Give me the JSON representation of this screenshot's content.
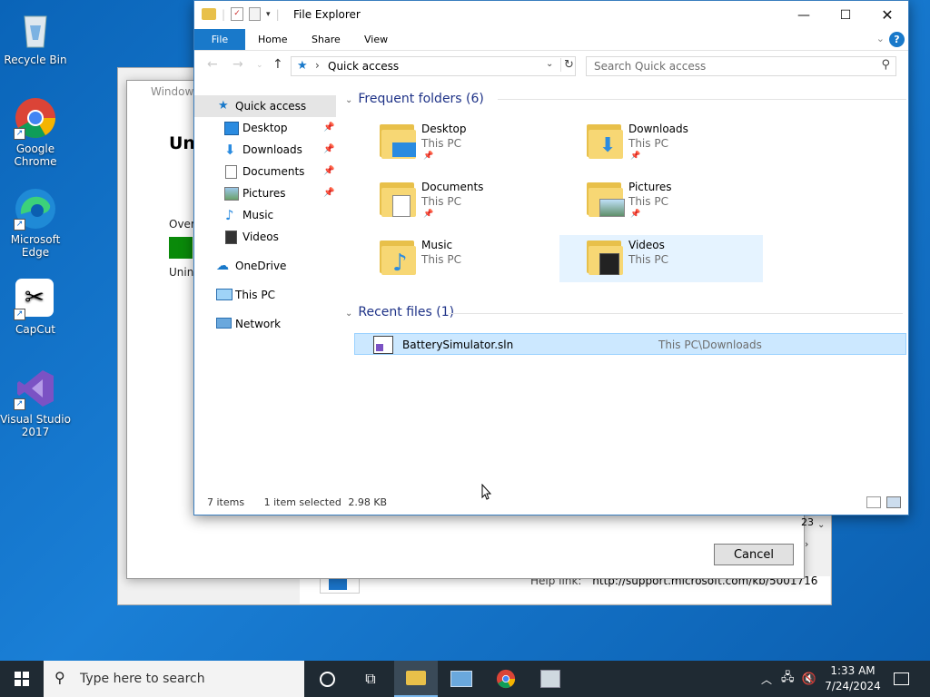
{
  "desktop": {
    "icons": [
      {
        "label": "Recycle Bin"
      },
      {
        "label": "Google Chrome"
      },
      {
        "label": "Microsoft Edge"
      },
      {
        "label": "CapCut"
      },
      {
        "label": "Visual Studio 2017"
      }
    ]
  },
  "background_window": {
    "title": "Windows",
    "heading": "Un",
    "over_label": "Over",
    "unin_label": "Unin",
    "cancel_label": "Cancel",
    "help_link_label": "Help link:",
    "help_link_url": "http://support.microsoft.com/kb/5001716",
    "scroll_text": "23"
  },
  "explorer": {
    "title": "File Explorer",
    "ribbon_tabs": [
      "File",
      "Home",
      "Share",
      "View"
    ],
    "address": "Quick access",
    "search_placeholder": "Search Quick access",
    "nav": [
      {
        "label": "Quick access",
        "selected": true
      },
      {
        "label": "Desktop",
        "pinned": true
      },
      {
        "label": "Downloads",
        "pinned": true
      },
      {
        "label": "Documents",
        "pinned": true
      },
      {
        "label": "Pictures",
        "pinned": true
      },
      {
        "label": "Music"
      },
      {
        "label": "Videos"
      },
      {
        "label": "OneDrive"
      },
      {
        "label": "This PC"
      },
      {
        "label": "Network"
      }
    ],
    "frequent_header": "Frequent folders (6)",
    "folders": [
      {
        "name": "Desktop",
        "location": "This PC",
        "pinned": true
      },
      {
        "name": "Downloads",
        "location": "This PC",
        "pinned": true
      },
      {
        "name": "Documents",
        "location": "This PC",
        "pinned": true
      },
      {
        "name": "Pictures",
        "location": "This PC",
        "pinned": true
      },
      {
        "name": "Music",
        "location": "This PC"
      },
      {
        "name": "Videos",
        "location": "This PC",
        "selected": true
      }
    ],
    "recent_header": "Recent files (1)",
    "recent_files": [
      {
        "name": "BatterySimulator.sln",
        "path": "This PC\\Downloads"
      }
    ],
    "status": {
      "items": "7 items",
      "selected": "1 item selected",
      "size": "2.98 KB"
    }
  },
  "taskbar": {
    "search_placeholder": "Type here to search",
    "time": "1:33 AM",
    "date": "7/24/2024"
  },
  "colors": {
    "accent": "#1979ca",
    "taskbar": "#1f2a33",
    "selection": "#cce8ff"
  }
}
